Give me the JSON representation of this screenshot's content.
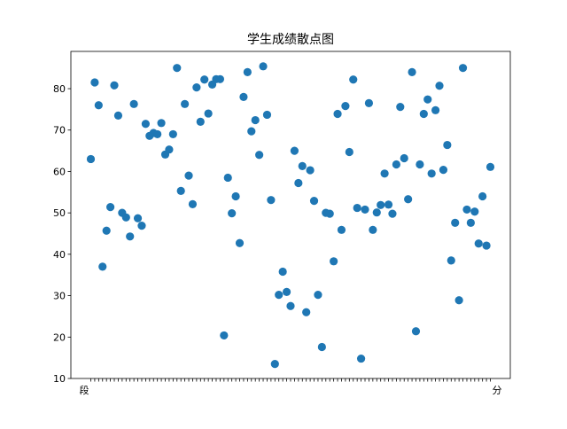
{
  "chart_data": {
    "type": "scatter",
    "title": "学生成绩散点图",
    "xlabel": "",
    "ylabel": "",
    "ylim": [
      10,
      89
    ],
    "yticks": [
      10,
      20,
      30,
      40,
      50,
      60,
      70,
      80
    ],
    "grid": false,
    "legend": "none",
    "colors": {
      "point": "#1f77b4",
      "axis": "#000000",
      "background": "#ffffff"
    },
    "x_tick_labels_first": "段",
    "x_tick_labels_last": "分",
    "y": [
      63.0,
      81.5,
      76.0,
      37.0,
      45.7,
      51.4,
      80.8,
      73.5,
      50.0,
      48.9,
      44.3,
      76.3,
      48.7,
      46.9,
      71.5,
      68.6,
      69.3,
      69.0,
      71.7,
      64.1,
      65.3,
      69.0,
      85.0,
      55.3,
      76.3,
      59.0,
      52.1,
      80.3,
      72.0,
      82.2,
      74.0,
      81.0,
      82.3,
      82.3,
      20.4,
      58.5,
      49.9,
      54.0,
      42.7,
      78.0,
      84.0,
      69.7,
      72.4,
      64.0,
      85.4,
      73.7,
      53.1,
      13.5,
      30.2,
      35.8,
      30.9,
      27.5,
      65.0,
      57.2,
      61.3,
      26.0,
      60.3,
      52.9,
      30.2,
      17.6,
      50.0,
      49.8,
      38.3,
      73.9,
      45.9,
      75.8,
      64.7,
      82.2,
      51.2,
      14.8,
      50.8,
      76.5,
      45.9,
      50.1,
      51.9,
      59.5,
      52.0,
      49.8,
      61.7,
      75.6,
      63.2,
      53.3,
      84.0,
      21.4,
      61.7,
      73.9,
      77.4,
      59.5,
      74.8,
      80.7,
      60.4,
      66.4,
      38.5,
      47.6,
      28.9,
      85.0,
      50.8,
      47.6,
      50.3,
      42.6,
      54.0,
      42.1,
      61.1
    ]
  }
}
